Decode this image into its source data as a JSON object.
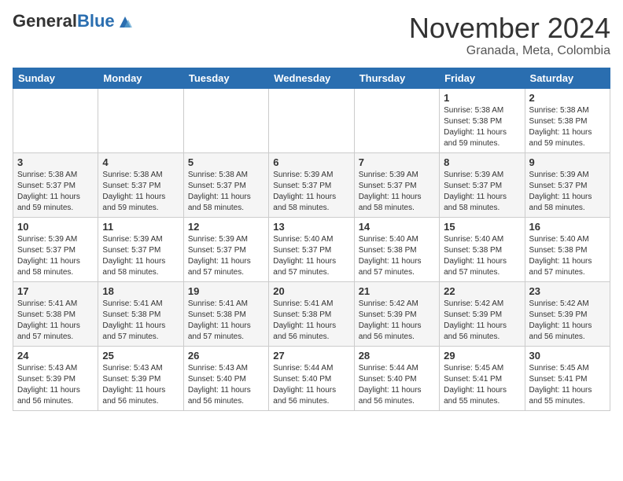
{
  "header": {
    "logo": {
      "general": "General",
      "blue": "Blue"
    },
    "title": "November 2024",
    "location": "Granada, Meta, Colombia"
  },
  "days_of_week": [
    "Sunday",
    "Monday",
    "Tuesday",
    "Wednesday",
    "Thursday",
    "Friday",
    "Saturday"
  ],
  "weeks": [
    [
      {
        "day": "",
        "info": ""
      },
      {
        "day": "",
        "info": ""
      },
      {
        "day": "",
        "info": ""
      },
      {
        "day": "",
        "info": ""
      },
      {
        "day": "",
        "info": ""
      },
      {
        "day": "1",
        "info": "Sunrise: 5:38 AM\nSunset: 5:38 PM\nDaylight: 11 hours and 59 minutes."
      },
      {
        "day": "2",
        "info": "Sunrise: 5:38 AM\nSunset: 5:38 PM\nDaylight: 11 hours and 59 minutes."
      }
    ],
    [
      {
        "day": "3",
        "info": "Sunrise: 5:38 AM\nSunset: 5:37 PM\nDaylight: 11 hours and 59 minutes."
      },
      {
        "day": "4",
        "info": "Sunrise: 5:38 AM\nSunset: 5:37 PM\nDaylight: 11 hours and 59 minutes."
      },
      {
        "day": "5",
        "info": "Sunrise: 5:38 AM\nSunset: 5:37 PM\nDaylight: 11 hours and 58 minutes."
      },
      {
        "day": "6",
        "info": "Sunrise: 5:39 AM\nSunset: 5:37 PM\nDaylight: 11 hours and 58 minutes."
      },
      {
        "day": "7",
        "info": "Sunrise: 5:39 AM\nSunset: 5:37 PM\nDaylight: 11 hours and 58 minutes."
      },
      {
        "day": "8",
        "info": "Sunrise: 5:39 AM\nSunset: 5:37 PM\nDaylight: 11 hours and 58 minutes."
      },
      {
        "day": "9",
        "info": "Sunrise: 5:39 AM\nSunset: 5:37 PM\nDaylight: 11 hours and 58 minutes."
      }
    ],
    [
      {
        "day": "10",
        "info": "Sunrise: 5:39 AM\nSunset: 5:37 PM\nDaylight: 11 hours and 58 minutes."
      },
      {
        "day": "11",
        "info": "Sunrise: 5:39 AM\nSunset: 5:37 PM\nDaylight: 11 hours and 58 minutes."
      },
      {
        "day": "12",
        "info": "Sunrise: 5:39 AM\nSunset: 5:37 PM\nDaylight: 11 hours and 57 minutes."
      },
      {
        "day": "13",
        "info": "Sunrise: 5:40 AM\nSunset: 5:37 PM\nDaylight: 11 hours and 57 minutes."
      },
      {
        "day": "14",
        "info": "Sunrise: 5:40 AM\nSunset: 5:38 PM\nDaylight: 11 hours and 57 minutes."
      },
      {
        "day": "15",
        "info": "Sunrise: 5:40 AM\nSunset: 5:38 PM\nDaylight: 11 hours and 57 minutes."
      },
      {
        "day": "16",
        "info": "Sunrise: 5:40 AM\nSunset: 5:38 PM\nDaylight: 11 hours and 57 minutes."
      }
    ],
    [
      {
        "day": "17",
        "info": "Sunrise: 5:41 AM\nSunset: 5:38 PM\nDaylight: 11 hours and 57 minutes."
      },
      {
        "day": "18",
        "info": "Sunrise: 5:41 AM\nSunset: 5:38 PM\nDaylight: 11 hours and 57 minutes."
      },
      {
        "day": "19",
        "info": "Sunrise: 5:41 AM\nSunset: 5:38 PM\nDaylight: 11 hours and 57 minutes."
      },
      {
        "day": "20",
        "info": "Sunrise: 5:41 AM\nSunset: 5:38 PM\nDaylight: 11 hours and 56 minutes."
      },
      {
        "day": "21",
        "info": "Sunrise: 5:42 AM\nSunset: 5:39 PM\nDaylight: 11 hours and 56 minutes."
      },
      {
        "day": "22",
        "info": "Sunrise: 5:42 AM\nSunset: 5:39 PM\nDaylight: 11 hours and 56 minutes."
      },
      {
        "day": "23",
        "info": "Sunrise: 5:42 AM\nSunset: 5:39 PM\nDaylight: 11 hours and 56 minutes."
      }
    ],
    [
      {
        "day": "24",
        "info": "Sunrise: 5:43 AM\nSunset: 5:39 PM\nDaylight: 11 hours and 56 minutes."
      },
      {
        "day": "25",
        "info": "Sunrise: 5:43 AM\nSunset: 5:39 PM\nDaylight: 11 hours and 56 minutes."
      },
      {
        "day": "26",
        "info": "Sunrise: 5:43 AM\nSunset: 5:40 PM\nDaylight: 11 hours and 56 minutes."
      },
      {
        "day": "27",
        "info": "Sunrise: 5:44 AM\nSunset: 5:40 PM\nDaylight: 11 hours and 56 minutes."
      },
      {
        "day": "28",
        "info": "Sunrise: 5:44 AM\nSunset: 5:40 PM\nDaylight: 11 hours and 56 minutes."
      },
      {
        "day": "29",
        "info": "Sunrise: 5:45 AM\nSunset: 5:41 PM\nDaylight: 11 hours and 55 minutes."
      },
      {
        "day": "30",
        "info": "Sunrise: 5:45 AM\nSunset: 5:41 PM\nDaylight: 11 hours and 55 minutes."
      }
    ]
  ]
}
